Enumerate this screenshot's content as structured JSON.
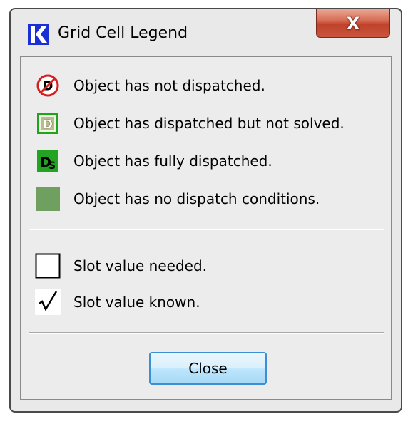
{
  "window": {
    "title": "Grid Cell Legend",
    "close_glyph": "X"
  },
  "legend": {
    "dispatch_items": [
      {
        "icon": "not-dispatched-icon",
        "label": "Object has not dispatched."
      },
      {
        "icon": "dispatched-not-solved-icon",
        "label": "Object has dispatched but not solved."
      },
      {
        "icon": "fully-dispatched-icon",
        "label": "Object has fully dispatched."
      },
      {
        "icon": "no-dispatch-conditions-icon",
        "label": "Object has no dispatch conditions."
      }
    ],
    "slot_items": [
      {
        "icon": "slot-needed-icon",
        "label": "Slot value needed."
      },
      {
        "icon": "checkmark-icon",
        "label": "Slot value known."
      }
    ]
  },
  "buttons": {
    "close_label": "Close"
  },
  "colors": {
    "not_dispatched_red": "#d81e1e",
    "dispatched_green_border": "#1ca61c",
    "dispatched_fill": "#b7bd8c",
    "fully_dispatched_green": "#22a322",
    "no_dispatch_green": "#6fa060",
    "close_button_border": "#3c8fd4",
    "title_close_red": "#c9553d"
  }
}
